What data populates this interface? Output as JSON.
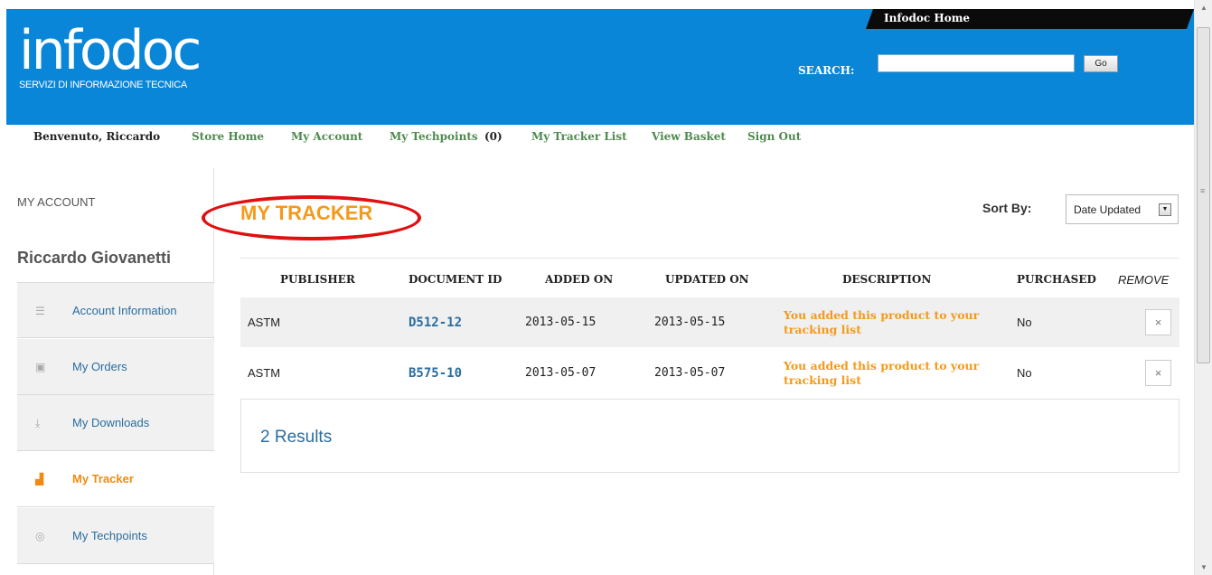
{
  "header": {
    "logo_word": "infodoc",
    "logo_tagline": "SERVIZI DI INFORMAZIONE TECNICA",
    "home_link": "Infodoc Home",
    "search_label": "SEARCH:",
    "search_value": "",
    "go_label": "Go"
  },
  "nav": {
    "welcome": "Benvenuto, Riccardo",
    "links": [
      "Store Home",
      "My Account",
      "My Techpoints",
      "My Tracker List",
      "View Basket",
      "Sign Out"
    ],
    "techpoints_count": "(0)"
  },
  "sidebar": {
    "title": "MY ACCOUNT",
    "user_name": "Riccardo Giovanetti",
    "items": [
      {
        "label": "Account Information",
        "icon": "list-icon"
      },
      {
        "label": "My Orders",
        "icon": "calendar-icon"
      },
      {
        "label": "My Downloads",
        "icon": "download-icon"
      },
      {
        "label": "My Tracker",
        "icon": "tracker-icon",
        "active": true
      },
      {
        "label": "My Techpoints",
        "icon": "coins-icon"
      }
    ]
  },
  "main": {
    "title": "MY TRACKER",
    "sort_label": "Sort By:",
    "sort_value": "Date Updated",
    "columns": [
      "PUBLISHER",
      "DOCUMENT ID",
      "ADDED ON",
      "UPDATED ON",
      "DESCRIPTION",
      "PURCHASED",
      "REMOVE"
    ],
    "rows": [
      {
        "publisher": "ASTM",
        "document_id": "D512-12",
        "added_on": "2013-05-15",
        "updated_on": "2013-05-15",
        "description": "You added this product to your tracking list",
        "purchased": "No",
        "remove": "×"
      },
      {
        "publisher": "ASTM",
        "document_id": "B575-10",
        "added_on": "2013-05-07",
        "updated_on": "2013-05-07",
        "description": "You added this product to your tracking list",
        "purchased": "No",
        "remove": "×"
      }
    ],
    "results": "2 Results"
  },
  "colors": {
    "header_blue": "#0a86d8",
    "accent_orange": "#f39a1b",
    "link_green": "#4f8a4f",
    "link_blue": "#2a6da0",
    "highlight_red": "#e01010"
  }
}
